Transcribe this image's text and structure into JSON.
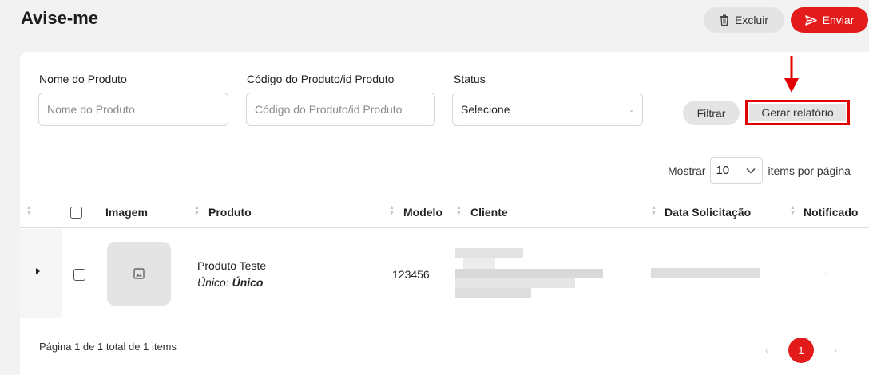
{
  "header": {
    "title": "Avise-me",
    "delete_label": "Excluir",
    "send_label": "Enviar"
  },
  "filters": {
    "product_name": {
      "label": "Nome do Produto",
      "placeholder": "Nome do Produto",
      "value": ""
    },
    "product_code": {
      "label": "Código do Produto/id Produto",
      "placeholder": "Código do Produto/id Produto",
      "value": ""
    },
    "status": {
      "label": "Status",
      "selected": "Selecione"
    },
    "filter_label": "Filtrar",
    "report_label": "Gerar relatório"
  },
  "pagination_size": {
    "show_label": "Mostrar",
    "value": "10",
    "suffix": "items por página"
  },
  "table": {
    "columns": [
      "Imagem",
      "Produto",
      "Modelo",
      "Cliente",
      "Data Solicitação",
      "Notificado"
    ],
    "rows": [
      {
        "product": "Produto Teste",
        "variant_label": "Único:",
        "variant_value": "Único",
        "model": "123456",
        "notified": "-"
      }
    ]
  },
  "footer": {
    "summary": "Página 1 de 1 total de 1 items",
    "current_page": "1"
  },
  "colors": {
    "accent": "#e31b1b",
    "highlight_box": "#e20000"
  }
}
